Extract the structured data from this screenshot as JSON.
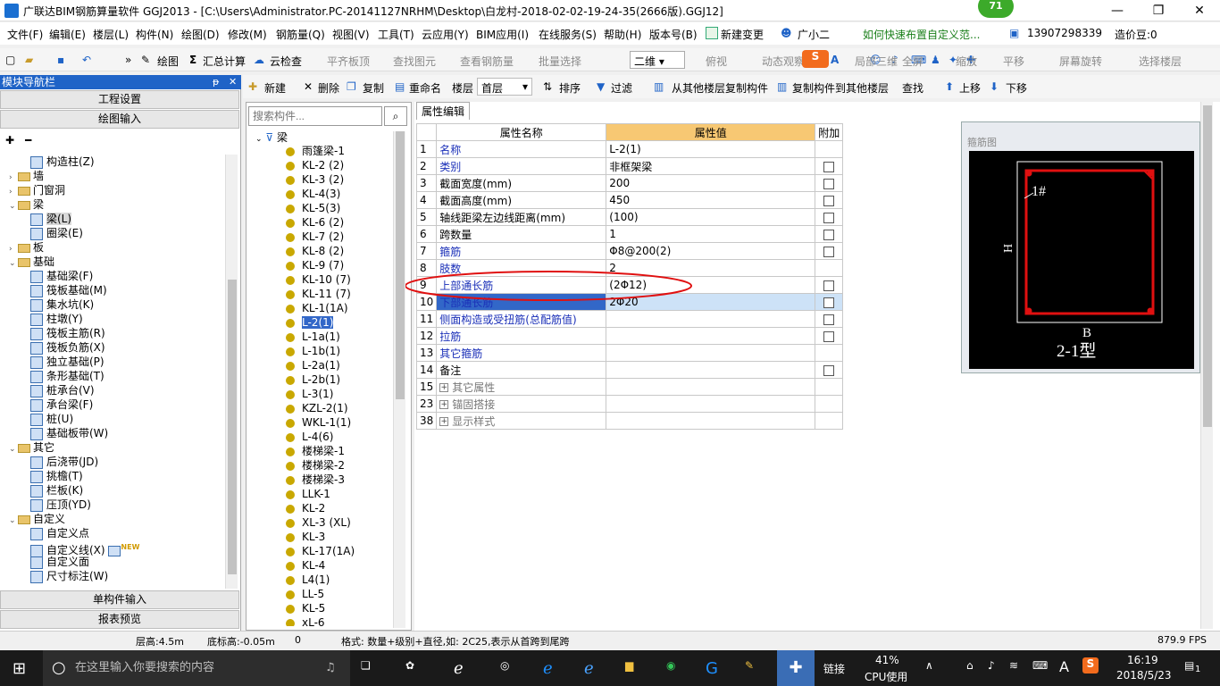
{
  "titlebar": {
    "title": "广联达BIM钢筋算量软件 GGJ2013 - [C:\\Users\\Administrator.PC-20141127NRHM\\Desktop\\白龙村-2018-02-02-19-24-35(2666版).GGJ12]",
    "badge": "71",
    "minimize": "—",
    "restore": "❐",
    "close": "✕"
  },
  "menubar": {
    "items": [
      "文件(F)",
      "编辑(E)",
      "楼层(L)",
      "构件(N)",
      "绘图(D)",
      "修改(M)",
      "钢筋量(Q)",
      "视图(V)",
      "工具(T)",
      "云应用(Y)",
      "BIM应用(I)",
      "在线服务(S)",
      "帮助(H)",
      "版本号(B)"
    ],
    "new_change": "新建变更",
    "assistant": "广小二",
    "tip": "如何快速布置自定义范...",
    "phone": "13907298339",
    "price": "造价豆:0"
  },
  "toolbar1": {
    "draw": "绘图",
    "sum_calc": "汇总计算",
    "cloud_check": "云检查",
    "align_top": "平齐板顶",
    "find_element": "查找图元",
    "view_rebar": "查看钢筋量",
    "batch_select": "批量选择",
    "view_mode": "二维",
    "top_view": "俯视",
    "dynamic_view": "动态观察",
    "local_3d": "局部三维",
    "fullscreen": "全屏",
    "zoom": "缩放",
    "pan": "平移",
    "rotate": "屏幕旋转",
    "select_floor": "选择楼层"
  },
  "leftpanel": {
    "header": "模块导航栏",
    "pin": "ᵽ",
    "close": "✕",
    "project_settings": "工程设置",
    "drawing_input": "绘图输入",
    "single_input": "单构件输入",
    "report_preview": "报表预览",
    "tree": [
      {
        "label": "构造柱(Z)",
        "indent": 3,
        "type": "leaf"
      },
      {
        "label": "墙",
        "indent": 1,
        "type": "folder",
        "exp": "›"
      },
      {
        "label": "门窗洞",
        "indent": 1,
        "type": "folder",
        "exp": "›"
      },
      {
        "label": "梁",
        "indent": 1,
        "type": "folder",
        "exp": "⌄"
      },
      {
        "label": "梁(L)",
        "indent": 3,
        "type": "leaf",
        "sel": true
      },
      {
        "label": "圈梁(E)",
        "indent": 3,
        "type": "leaf"
      },
      {
        "label": "板",
        "indent": 1,
        "type": "folder",
        "exp": "›"
      },
      {
        "label": "基础",
        "indent": 1,
        "type": "folder",
        "exp": "⌄"
      },
      {
        "label": "基础梁(F)",
        "indent": 3,
        "type": "leaf"
      },
      {
        "label": "筏板基础(M)",
        "indent": 3,
        "type": "leaf"
      },
      {
        "label": "集水坑(K)",
        "indent": 3,
        "type": "leaf"
      },
      {
        "label": "柱墩(Y)",
        "indent": 3,
        "type": "leaf"
      },
      {
        "label": "筏板主筋(R)",
        "indent": 3,
        "type": "leaf"
      },
      {
        "label": "筏板负筋(X)",
        "indent": 3,
        "type": "leaf"
      },
      {
        "label": "独立基础(P)",
        "indent": 3,
        "type": "leaf"
      },
      {
        "label": "条形基础(T)",
        "indent": 3,
        "type": "leaf"
      },
      {
        "label": "桩承台(V)",
        "indent": 3,
        "type": "leaf"
      },
      {
        "label": "承台梁(F)",
        "indent": 3,
        "type": "leaf"
      },
      {
        "label": "桩(U)",
        "indent": 3,
        "type": "leaf"
      },
      {
        "label": "基础板带(W)",
        "indent": 3,
        "type": "leaf"
      },
      {
        "label": "其它",
        "indent": 1,
        "type": "folder",
        "exp": "⌄"
      },
      {
        "label": "后浇带(JD)",
        "indent": 3,
        "type": "leaf"
      },
      {
        "label": "挑檐(T)",
        "indent": 3,
        "type": "leaf"
      },
      {
        "label": "栏板(K)",
        "indent": 3,
        "type": "leaf"
      },
      {
        "label": "压顶(YD)",
        "indent": 3,
        "type": "leaf"
      },
      {
        "label": "自定义",
        "indent": 1,
        "type": "folder",
        "exp": "⌄"
      },
      {
        "label": "自定义点",
        "indent": 3,
        "type": "leaf"
      },
      {
        "label": "自定义线(X)",
        "indent": 3,
        "type": "leaf",
        "new": "NEW"
      },
      {
        "label": "自定义面",
        "indent": 3,
        "type": "leaf"
      },
      {
        "label": "尺寸标注(W)",
        "indent": 3,
        "type": "leaf"
      }
    ]
  },
  "toolbar2": {
    "new": "新建",
    "delete": "删除",
    "copy": "复制",
    "rename": "重命名",
    "floor_label": "楼层",
    "floor_value": "首层",
    "sort": "排序",
    "filter": "过滤",
    "copy_from_floor": "从其他楼层复制构件",
    "copy_to_floor": "复制构件到其他楼层",
    "find": "查找",
    "move_up": "上移",
    "move_down": "下移"
  },
  "midpanel": {
    "search_placeholder": "搜索构件...",
    "root": "梁",
    "items": [
      "雨篷梁-1",
      "KL-2 (2)",
      "KL-3 (2)",
      "KL-4(3)",
      "KL-5(3)",
      "KL-6 (2)",
      "KL-7 (2)",
      "KL-8 (2)",
      "KL-9 (7)",
      "KL-10 (7)",
      "KL-11 (7)",
      "KL-1(1A)",
      "L-2(1)",
      "L-1a(1)",
      "L-1b(1)",
      "L-2a(1)",
      "L-2b(1)",
      "L-3(1)",
      "KZL-2(1)",
      "WKL-1(1)",
      "L-4(6)",
      "楼梯梁-1",
      "楼梯梁-2",
      "楼梯梁-3",
      "LLK-1",
      "KL-2",
      "XL-3 (XL)",
      "KL-3",
      "KL-17(1A)",
      "KL-4",
      "L4(1)",
      "LL-5",
      "KL-5",
      "xL-6"
    ],
    "selected_index": 12
  },
  "props": {
    "tab": "属性编辑",
    "col_name": "属性名称",
    "col_value": "属性值",
    "col_add": "附加",
    "rows": [
      {
        "num": "1",
        "name": "名称",
        "value": "L-2(1)",
        "cb": false,
        "style": "name"
      },
      {
        "num": "2",
        "name": "类别",
        "value": "非框架梁",
        "cb": true,
        "style": "name"
      },
      {
        "num": "3",
        "name": "截面宽度(mm)",
        "value": "200",
        "cb": true,
        "style": "blk"
      },
      {
        "num": "4",
        "name": "截面高度(mm)",
        "value": "450",
        "cb": true,
        "style": "blk"
      },
      {
        "num": "5",
        "name": "轴线距梁左边线距离(mm)",
        "value": "(100)",
        "cb": true,
        "style": "blk"
      },
      {
        "num": "6",
        "name": "跨数量",
        "value": "1",
        "cb": true,
        "style": "blk"
      },
      {
        "num": "7",
        "name": "箍筋",
        "value": "Φ8@200(2)",
        "cb": true,
        "style": "name"
      },
      {
        "num": "8",
        "name": "肢数",
        "value": "2",
        "cb": false,
        "style": "name"
      },
      {
        "num": "9",
        "name": "上部通长筋",
        "value": "(2Φ12)",
        "cb": true,
        "style": "name"
      },
      {
        "num": "10",
        "name": "下部通长筋",
        "value": "2Φ20",
        "cb": true,
        "style": "name",
        "sel": true
      },
      {
        "num": "11",
        "name": "侧面构造或受扭筋(总配筋值)",
        "value": "",
        "cb": true,
        "style": "name"
      },
      {
        "num": "12",
        "name": "拉筋",
        "value": "",
        "cb": true,
        "style": "name"
      },
      {
        "num": "13",
        "name": "其它箍筋",
        "value": "",
        "cb": false,
        "style": "name"
      },
      {
        "num": "14",
        "name": "备注",
        "value": "",
        "cb": true,
        "style": "blk"
      },
      {
        "num": "15",
        "name": "其它属性",
        "value": "",
        "cb": false,
        "style": "gry",
        "plus": true
      },
      {
        "num": "23",
        "name": "锚固搭接",
        "value": "",
        "cb": false,
        "style": "gry",
        "plus": true
      },
      {
        "num": "38",
        "name": "显示样式",
        "value": "",
        "cb": false,
        "style": "gry",
        "plus": true
      }
    ]
  },
  "stirrup": {
    "label": "箍筋图",
    "bar_label": "1#",
    "h_label": "H",
    "b_label": "B",
    "type_label": "2-1型"
  },
  "statusbar": {
    "floor_height": "层高:4.5m",
    "bottom_elev": "底标高:-0.05m",
    "zero": "0",
    "format_tip": "格式: 数量+级别+直径,如: 2C25,表示从首跨到尾跨",
    "fps": "879.9 FPS"
  },
  "taskbar": {
    "search_placeholder": "在这里输入你要搜索的内容",
    "link": "链接",
    "cpu_pct": "41%",
    "cpu_label": "CPU使用",
    "ime": "A",
    "time": "16:19",
    "date": "2018/5/23",
    "notif": "1"
  },
  "colors": {
    "accent": "#1f63c7",
    "selection": "#3267c8",
    "value_header": "#f7c873",
    "annotation": "#e01010"
  }
}
